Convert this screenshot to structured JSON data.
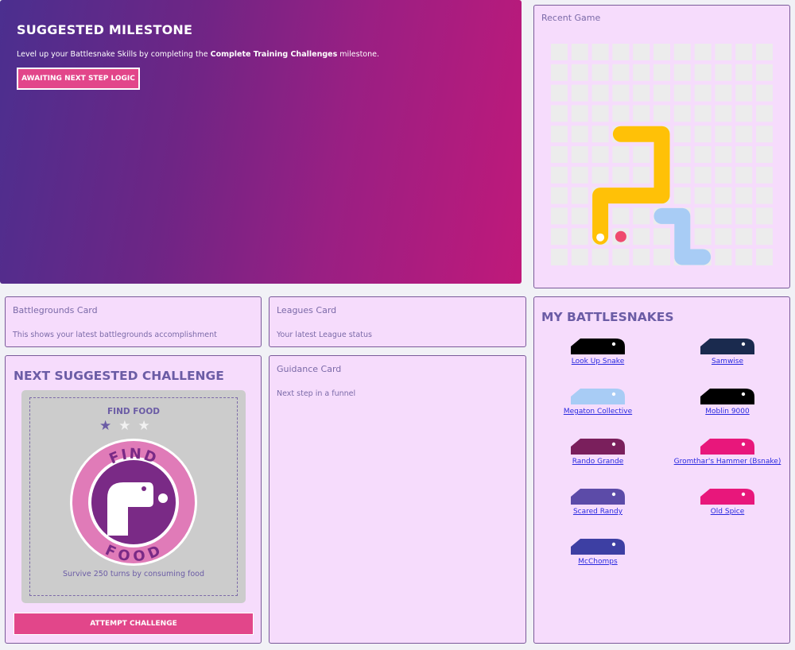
{
  "hero": {
    "title": "SUGGESTED MILESTONE",
    "text_before": "Level up your Battlesnake Skills by completing the ",
    "text_bold": "Complete Training Challenges",
    "text_after": " milestone.",
    "button_label": "AWAITING NEXT STEP LOGIC"
  },
  "recent_game": {
    "title": "Recent Game"
  },
  "battlegrounds": {
    "title": "Battlegrounds Card",
    "subtitle": "This shows your latest battlegrounds accomplishment"
  },
  "leagues": {
    "title": "Leagues Card",
    "subtitle": "Your latest League status"
  },
  "guidance": {
    "title": "Guidance Card",
    "subtitle": "Next step in a funnel"
  },
  "challenge": {
    "heading": "NEXT SUGGESTED CHALLENGE",
    "name": "FIND FOOD",
    "stars_filled": 1,
    "stars_total": 3,
    "badge_top": "FIND",
    "badge_bottom": "FOOD",
    "description": "Survive 250 turns by consuming food",
    "button_label": "ATTEMPT CHALLENGE"
  },
  "battlesnakes": {
    "heading": "MY BATTLESNAKES",
    "items": [
      {
        "name": "Look Up Snake",
        "color": "#000000"
      },
      {
        "name": "Samwise",
        "color": "#1a2a4e"
      },
      {
        "name": "Megaton Collective",
        "color": "#a8ccf5"
      },
      {
        "name": "Moblin 9000",
        "color": "#000000"
      },
      {
        "name": "Rando Grande",
        "color": "#7a1f5c"
      },
      {
        "name": "Gromthar's Hammer (Bsnake)",
        "color": "#e8177b"
      },
      {
        "name": "Scared Randy",
        "color": "#5c4ba8"
      },
      {
        "name": "Old Spice",
        "color": "#e8177b"
      },
      {
        "name": "McChomps",
        "color": "#3d3fa3"
      }
    ]
  },
  "colors": {
    "accent": "#e2468a",
    "card_bg": "#f6dcfc",
    "heading": "#6b5ca5",
    "snake_yellow": "#ffc107",
    "snake_blue": "#a8ccf5",
    "food": "#ef4a6e"
  }
}
